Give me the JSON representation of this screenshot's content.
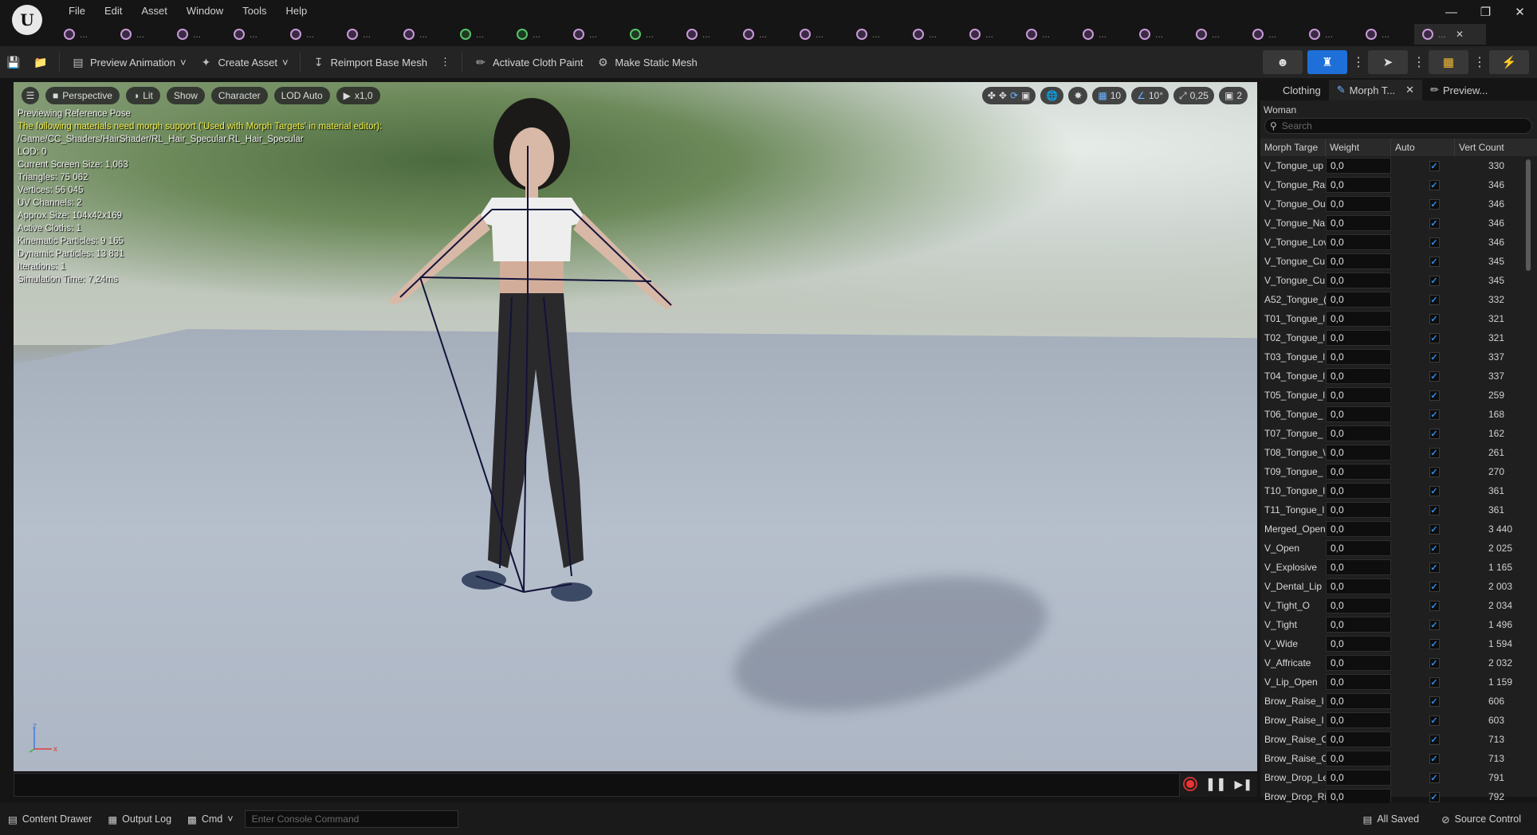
{
  "app": {
    "logo_letter": "U"
  },
  "menu": [
    "File",
    "Edit",
    "Asset",
    "Window",
    "Tools",
    "Help"
  ],
  "window_controls": {
    "minimize": "—",
    "restore": "❐",
    "close": "✕"
  },
  "asset_tabs": [
    {
      "label": "..."
    },
    {
      "label": "..."
    },
    {
      "label": "..."
    },
    {
      "label": "..."
    },
    {
      "label": "..."
    },
    {
      "label": "..."
    },
    {
      "label": "..."
    },
    {
      "label": "..."
    },
    {
      "label": "..."
    },
    {
      "label": "..."
    },
    {
      "label": "..."
    },
    {
      "label": "..."
    },
    {
      "label": "..."
    },
    {
      "label": "..."
    },
    {
      "label": "..."
    },
    {
      "label": "..."
    },
    {
      "label": "..."
    },
    {
      "label": "..."
    },
    {
      "label": "..."
    },
    {
      "label": "..."
    },
    {
      "label": "..."
    },
    {
      "label": "..."
    },
    {
      "label": "..."
    },
    {
      "label": "..."
    },
    {
      "label": "...",
      "active": true
    }
  ],
  "toolbar": {
    "preview_animation": "Preview Animation",
    "create_asset": "Create Asset",
    "reimport_base_mesh": "Reimport Base Mesh",
    "activate_cloth_paint": "Activate Cloth Paint",
    "make_static_mesh": "Make Static Mesh"
  },
  "viewport": {
    "perspective": "Perspective",
    "lit": "Lit",
    "show": "Show",
    "character": "Character",
    "lod": "LOD Auto",
    "speed": "x1,0",
    "grid_snap": "10",
    "rot_snap": "10°",
    "scale_snap": "0,25",
    "camera_speed": "2",
    "info": [
      {
        "text": "Previewing Reference Pose",
        "warn": false
      },
      {
        "text": "The following materials need morph support ('Used with Morph Targets' in material editor):",
        "warn": true
      },
      {
        "text": "/Game/CC_Shaders/HairShader/RL_Hair_Specular.RL_Hair_Specular",
        "warn": false
      },
      {
        "text": "LOD: 0",
        "warn": false
      },
      {
        "text": "Current Screen Size: 1,063",
        "warn": false
      },
      {
        "text": "Triangles: 75 062",
        "warn": false
      },
      {
        "text": "Vertices: 56 045",
        "warn": false
      },
      {
        "text": "UV Channels: 2",
        "warn": false
      },
      {
        "text": "Approx Size: 104x42x169",
        "warn": false
      },
      {
        "text": "Active Cloths: 1",
        "warn": false
      },
      {
        "text": "Kinematic Particles: 9 165",
        "warn": false
      },
      {
        "text": "Dynamic Particles: 13 831",
        "warn": false
      },
      {
        "text": "Iterations: 1",
        "warn": false
      },
      {
        "text": "Simulation Time: 7,24ms",
        "warn": false
      }
    ],
    "axis_z": "z",
    "axis_x": "x"
  },
  "panel": {
    "tabs": [
      {
        "label": "Clothing",
        "active": false
      },
      {
        "label": "Morph T...",
        "active": true
      },
      {
        "label": "Preview...",
        "active": false
      }
    ],
    "mesh_name": "Woman",
    "search_placeholder": "Search",
    "columns": [
      "Morph Targe",
      "Weight",
      "Auto",
      "Vert Count"
    ],
    "rows": [
      {
        "name": "V_Tongue_up",
        "weight": "0,0",
        "vert": "330"
      },
      {
        "name": "V_Tongue_Rai",
        "weight": "0,0",
        "vert": "346"
      },
      {
        "name": "V_Tongue_Ou",
        "weight": "0,0",
        "vert": "346"
      },
      {
        "name": "V_Tongue_Na",
        "weight": "0,0",
        "vert": "346"
      },
      {
        "name": "V_Tongue_Lov",
        "weight": "0,0",
        "vert": "346"
      },
      {
        "name": "V_Tongue_Cu",
        "weight": "0,0",
        "vert": "345"
      },
      {
        "name": "V_Tongue_Cu",
        "weight": "0,0",
        "vert": "345"
      },
      {
        "name": "A52_Tongue_(",
        "weight": "0,0",
        "vert": "332"
      },
      {
        "name": "T01_Tongue_l",
        "weight": "0,0",
        "vert": "321"
      },
      {
        "name": "T02_Tongue_l",
        "weight": "0,0",
        "vert": "321"
      },
      {
        "name": "T03_Tongue_l",
        "weight": "0,0",
        "vert": "337"
      },
      {
        "name": "T04_Tongue_l",
        "weight": "0,0",
        "vert": "337"
      },
      {
        "name": "T05_Tongue_l",
        "weight": "0,0",
        "vert": "259"
      },
      {
        "name": "T06_Tongue_",
        "weight": "0,0",
        "vert": "168"
      },
      {
        "name": "T07_Tongue_",
        "weight": "0,0",
        "vert": "162"
      },
      {
        "name": "T08_Tongue_\\",
        "weight": "0,0",
        "vert": "261"
      },
      {
        "name": "T09_Tongue_",
        "weight": "0,0",
        "vert": "270"
      },
      {
        "name": "T10_Tongue_l",
        "weight": "0,0",
        "vert": "361"
      },
      {
        "name": "T11_Tongue_l",
        "weight": "0,0",
        "vert": "361"
      },
      {
        "name": "Merged_Open",
        "weight": "0,0",
        "vert": "3 440"
      },
      {
        "name": "V_Open",
        "weight": "0,0",
        "vert": "2 025"
      },
      {
        "name": "V_Explosive",
        "weight": "0,0",
        "vert": "1 165"
      },
      {
        "name": "V_Dental_Lip",
        "weight": "0,0",
        "vert": "2 003"
      },
      {
        "name": "V_Tight_O",
        "weight": "0,0",
        "vert": "2 034"
      },
      {
        "name": "V_Tight",
        "weight": "0,0",
        "vert": "1 496"
      },
      {
        "name": "V_Wide",
        "weight": "0,0",
        "vert": "1 594"
      },
      {
        "name": "V_Affricate",
        "weight": "0,0",
        "vert": "2 032"
      },
      {
        "name": "V_Lip_Open",
        "weight": "0,0",
        "vert": "1 159"
      },
      {
        "name": "Brow_Raise_I",
        "weight": "0,0",
        "vert": "606"
      },
      {
        "name": "Brow_Raise_I",
        "weight": "0,0",
        "vert": "603"
      },
      {
        "name": "Brow_Raise_C",
        "weight": "0,0",
        "vert": "713"
      },
      {
        "name": "Brow_Raise_C",
        "weight": "0,0",
        "vert": "713"
      },
      {
        "name": "Brow_Drop_Le",
        "weight": "0,0",
        "vert": "791"
      },
      {
        "name": "Brow_Drop_Ri",
        "weight": "0,0",
        "vert": "792"
      }
    ]
  },
  "statusbar": {
    "content_drawer": "Content Drawer",
    "output_log": "Output Log",
    "cmd": "Cmd",
    "console_placeholder": "Enter Console Command",
    "all_saved": "All Saved",
    "source_control": "Source Control"
  },
  "colors": {
    "accent": "#1e70d8",
    "warning_text": "#f3f048",
    "checkbox": "#2f8ff0"
  }
}
